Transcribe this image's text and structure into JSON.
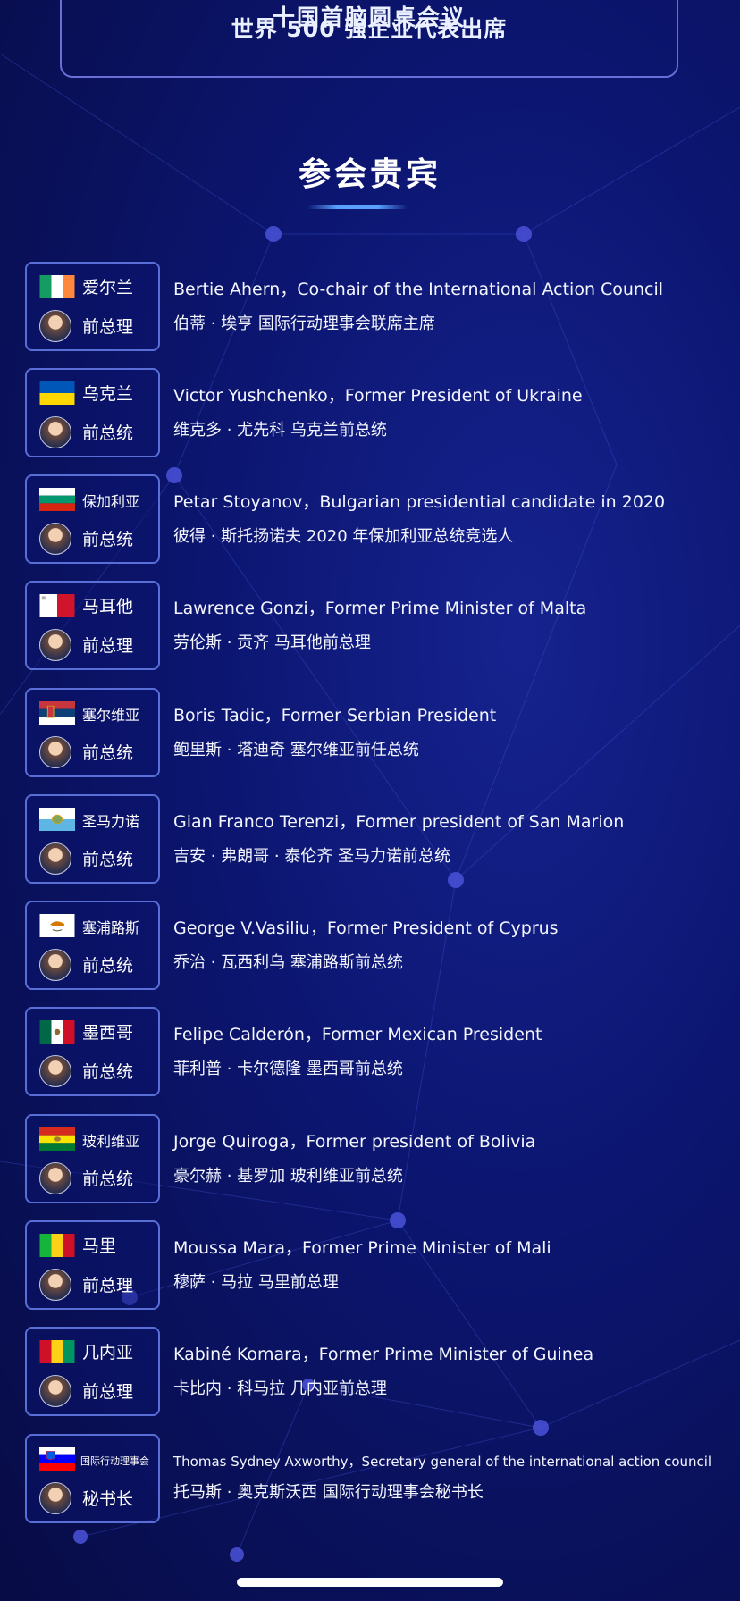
{
  "header": {
    "line1": "十国首脑圆桌会议",
    "line2": "世界 500 强企业代表出席"
  },
  "section_title": "参会贵宾",
  "colors": {
    "background": "#0c1672",
    "card_border": "#5a6ed8",
    "header_border": "#6a6fd8",
    "accent": "#5aa0ff"
  },
  "guests": [
    {
      "country": "爱尔兰",
      "position": "前总理",
      "flag": "ireland-flag-icon",
      "en": "Bertie Ahern，Co-chair of the International Action Council",
      "zh": "伯蒂 · 埃亨   国际行动理事会联席主席"
    },
    {
      "country": "乌克兰",
      "position": "前总统",
      "flag": "ukraine-flag-icon",
      "en": "Victor Yushchenko，Former President of Ukraine",
      "zh": "维克多 · 尤先科   乌克兰前总统"
    },
    {
      "country": "保加利亚",
      "position": "前总统",
      "flag": "bulgaria-flag-icon",
      "en": "Petar Stoyanov，Bulgarian presidential candidate in 2020",
      "zh": "彼得 · 斯托扬诺夫   2020 年保加利亚总统竞选人"
    },
    {
      "country": "马耳他",
      "position": "前总理",
      "flag": "malta-flag-icon",
      "en": "Lawrence Gonzi，Former Prime Minister of Malta",
      "zh": "劳伦斯 · 贡齐   马耳他前总理"
    },
    {
      "country": "塞尔维亚",
      "position": "前总统",
      "flag": "serbia-flag-icon",
      "en": "Boris Tadic，Former Serbian President",
      "zh": "鲍里斯 · 塔迪奇   塞尔维亚前任总统"
    },
    {
      "country": "圣马力诺",
      "position": "前总统",
      "flag": "san-marino-flag-icon",
      "en": "Gian Franco Terenzi，Former president of San Marion",
      "zh": "吉安 · 弗朗哥 · 泰伦齐   圣马力诺前总统"
    },
    {
      "country": "塞浦路斯",
      "position": "前总统",
      "flag": "cyprus-flag-icon",
      "en": "George V.Vasiliu，Former President of Cyprus",
      "zh": "乔治 · 瓦西利乌   塞浦路斯前总统"
    },
    {
      "country": "墨西哥",
      "position": "前总统",
      "flag": "mexico-flag-icon",
      "en": "Felipe Calderón，Former Mexican President",
      "zh": "菲利普 · 卡尔德隆   墨西哥前总统"
    },
    {
      "country": "玻利维亚",
      "position": "前总统",
      "flag": "bolivia-flag-icon",
      "en": "Jorge Quiroga，Former president of Bolivia",
      "zh": "豪尔赫 · 基罗加   玻利维亚前总统"
    },
    {
      "country": "马里",
      "position": "前总理",
      "flag": "mali-flag-icon",
      "en": "Moussa Mara，Former Prime Minister of Mali",
      "zh": "穆萨 · 马拉   马里前总理"
    },
    {
      "country": "几内亚",
      "position": "前总理",
      "flag": "guinea-flag-icon",
      "en": "Kabiné Komara，Former Prime Minister of Guinea",
      "zh": "卡比内 · 科马拉   几内亚前总理"
    },
    {
      "country": "国际行动理事会",
      "position": "秘书长",
      "flag": "slovenia-flag-icon",
      "en": "Thomas Sydney Axworthy，Secretary general of the international action council",
      "zh": "托马斯 · 奥克斯沃西   国际行动理事会秘书长"
    }
  ]
}
